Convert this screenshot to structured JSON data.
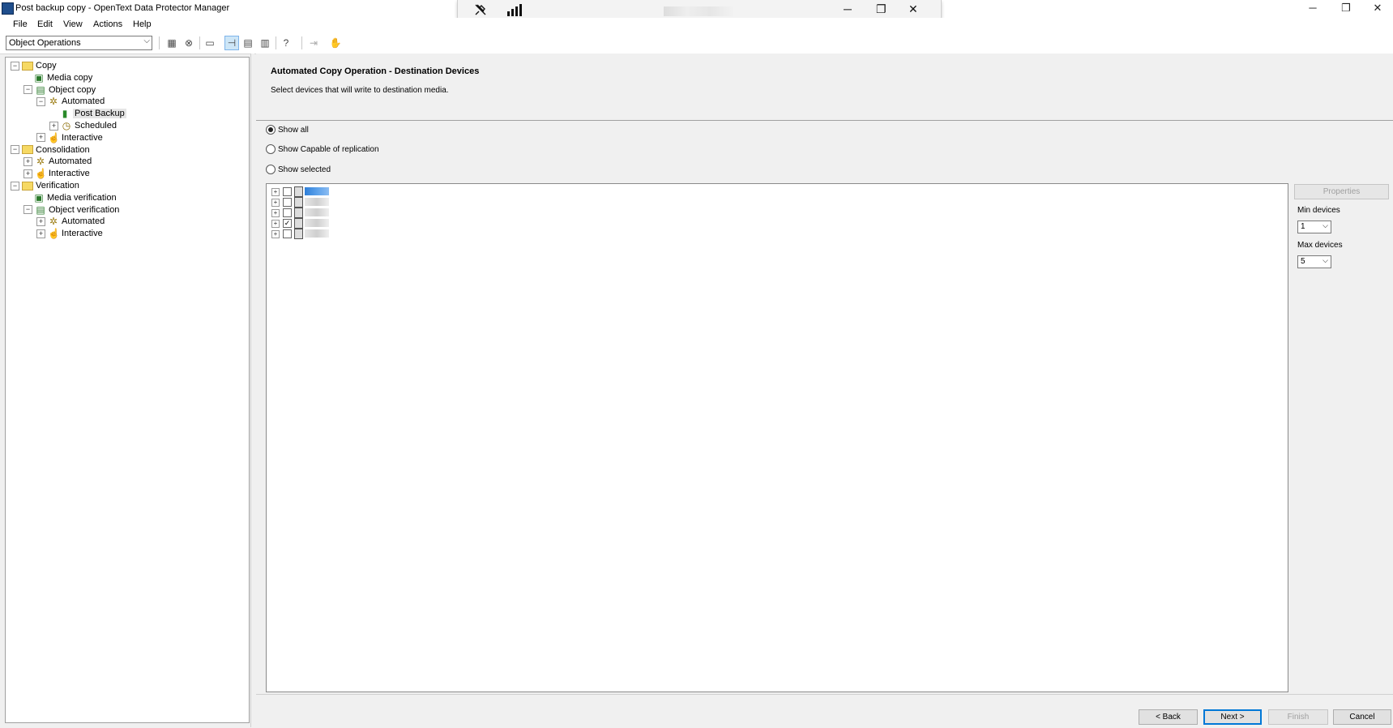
{
  "window": {
    "title": "Post backup copy - OpenText Data Protector Manager",
    "controls": {
      "minimize": "─",
      "maximize": "❐",
      "close": "✕"
    }
  },
  "remote_bar": {
    "pin_icon": "unpin-icon",
    "signal_icon": "signal-bars-icon",
    "controls": {
      "minimize": "─",
      "restore": "❐",
      "close": "✕"
    }
  },
  "menu": [
    "File",
    "Edit",
    "View",
    "Actions",
    "Help"
  ],
  "toolbar": {
    "context": "Object Operations",
    "help": "?"
  },
  "tree": [
    {
      "label": "Copy",
      "level": 0,
      "expand": "−",
      "icon": "folder"
    },
    {
      "label": "Media copy",
      "level": 1,
      "expand": "",
      "icon": "media"
    },
    {
      "label": "Object copy",
      "level": 1,
      "expand": "−",
      "icon": "object"
    },
    {
      "label": "Automated",
      "level": 2,
      "expand": "−",
      "icon": "gear"
    },
    {
      "label": "Post Backup",
      "level": 3,
      "expand": "",
      "icon": "doc",
      "selected": true
    },
    {
      "label": "Scheduled",
      "level": 3,
      "expand": "+",
      "icon": "clock"
    },
    {
      "label": "Interactive",
      "level": 2,
      "expand": "+",
      "icon": "hand"
    },
    {
      "label": "Consolidation",
      "level": 0,
      "expand": "−",
      "icon": "folder"
    },
    {
      "label": "Automated",
      "level": 1,
      "expand": "+",
      "icon": "gear"
    },
    {
      "label": "Interactive",
      "level": 1,
      "expand": "+",
      "icon": "hand"
    },
    {
      "label": "Verification",
      "level": 0,
      "expand": "−",
      "icon": "folder"
    },
    {
      "label": "Media verification",
      "level": 1,
      "expand": "",
      "icon": "media"
    },
    {
      "label": "Object verification",
      "level": 1,
      "expand": "−",
      "icon": "object"
    },
    {
      "label": "Automated",
      "level": 2,
      "expand": "+",
      "icon": "gear"
    },
    {
      "label": "Interactive",
      "level": 2,
      "expand": "+",
      "icon": "hand"
    }
  ],
  "wizard": {
    "title": "Automated Copy Operation - Destination Devices",
    "subtitle": "Select devices that will write to destination media.",
    "radios": [
      {
        "label": "Show all",
        "checked": true
      },
      {
        "label": "Show Capable of replication",
        "checked": false
      },
      {
        "label": "Show selected",
        "checked": false
      }
    ],
    "devices": [
      {
        "checked": false,
        "highlighted": true
      },
      {
        "checked": false,
        "highlighted": false
      },
      {
        "checked": false,
        "highlighted": false
      },
      {
        "checked": true,
        "highlighted": false
      },
      {
        "checked": false,
        "highlighted": false
      }
    ],
    "properties_label": "Properties",
    "min_devices_label": "Min devices",
    "min_devices_value": "1",
    "max_devices_label": "Max devices",
    "max_devices_value": "5",
    "buttons": {
      "back": "< Back",
      "next": "Next >",
      "finish": "Finish",
      "cancel": "Cancel"
    }
  }
}
